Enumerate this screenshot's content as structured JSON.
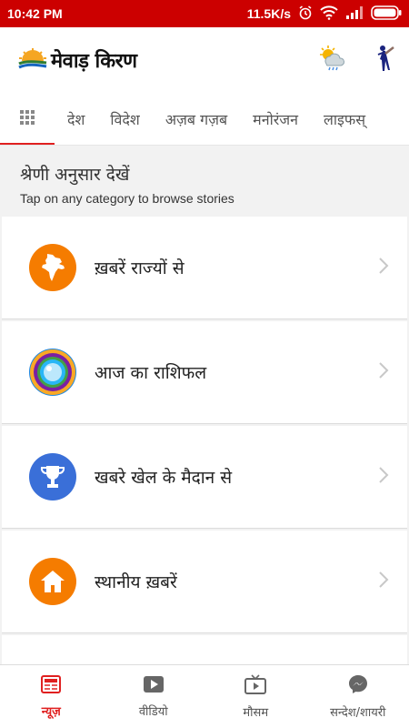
{
  "status": {
    "time": "10:42 PM",
    "speed": "11.5K/s"
  },
  "app": {
    "logo_text": "मेवाड़ किरण"
  },
  "tabs": [
    {
      "label": "देश"
    },
    {
      "label": "विदेश"
    },
    {
      "label": "अज़ब गज़ब"
    },
    {
      "label": "मनोरंजन"
    },
    {
      "label": "लाइफस्"
    }
  ],
  "section": {
    "title": "श्रेणी अनुसार देखें",
    "subtitle": "Tap on any category to browse stories"
  },
  "categories": [
    {
      "label": "ख़बरें राज्यों से",
      "icon": "india-map-icon",
      "color": "#f57c00"
    },
    {
      "label": "आज का राशिफल",
      "icon": "zodiac-wheel-icon",
      "color": "#1e88e5"
    },
    {
      "label": "खबरे खेल के मैदान से",
      "icon": "trophy-icon",
      "color": "#3a6fd8"
    },
    {
      "label": "स्थानीय ख़बरें",
      "icon": "home-icon",
      "color": "#f57c00"
    }
  ],
  "bottom_nav": [
    {
      "label": "न्यूज़",
      "icon": "news-icon",
      "active": true
    },
    {
      "label": "वीडियो",
      "icon": "video-icon",
      "active": false
    },
    {
      "label": "मौसम",
      "icon": "tv-icon",
      "active": false
    },
    {
      "label": "सन्देश/शायरी",
      "icon": "messenger-icon",
      "active": false
    }
  ],
  "colors": {
    "status_bar": "#cc0000",
    "accent": "#e02020"
  }
}
